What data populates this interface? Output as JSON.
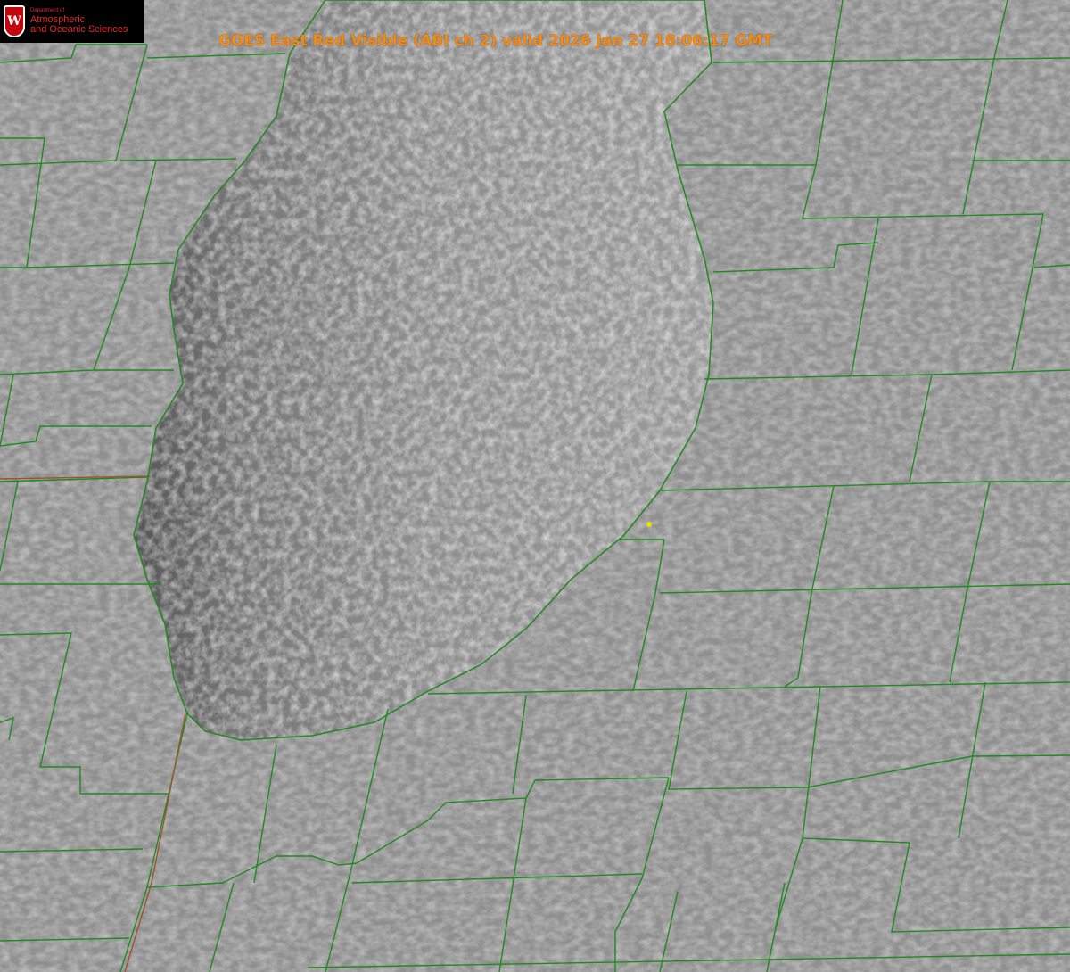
{
  "header": {
    "title": "GOES East Red Visible (ABI ch 2) valid 2026 Jan 27 18:06:17 GMT"
  },
  "logo": {
    "crest_letter": "W",
    "department": "Department of",
    "line1": "Atmospheric",
    "line2": "and Oceanic Sciences"
  },
  "map": {
    "product": "visible satellite imagery",
    "marker": "yellow-dot"
  },
  "colors": {
    "title": "#f28a17",
    "county_lines": "#1f8a1f",
    "state_line": "#a0522d",
    "lake_outline": "#d62020",
    "logo_text": "#e8252b",
    "marker": "#e8e000"
  }
}
